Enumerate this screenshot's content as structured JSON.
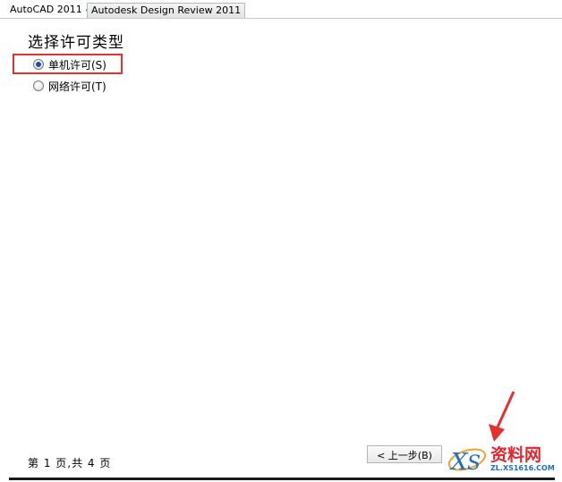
{
  "tabs": [
    {
      "label": "AutoCAD 2011",
      "status_icon": "checkmark-icon",
      "active": true
    },
    {
      "label": "Autodesk Design Review 2011",
      "active": false
    }
  ],
  "heading": "选择许可类型",
  "options": [
    {
      "label": "单机许可(S)",
      "selected": true
    },
    {
      "label": "网络许可(T)",
      "selected": false
    }
  ],
  "footer": {
    "page_count": "第 1 页,共 4 页",
    "back_label": "< 上一步(B)"
  },
  "annotation": {
    "highlight_color": "#e53030"
  },
  "watermark": {
    "brand": "资料网",
    "url": "ZL.XS1616.COM"
  },
  "colors": {
    "check": "#2f9e27",
    "radio_selected": "#1e4fa8"
  }
}
